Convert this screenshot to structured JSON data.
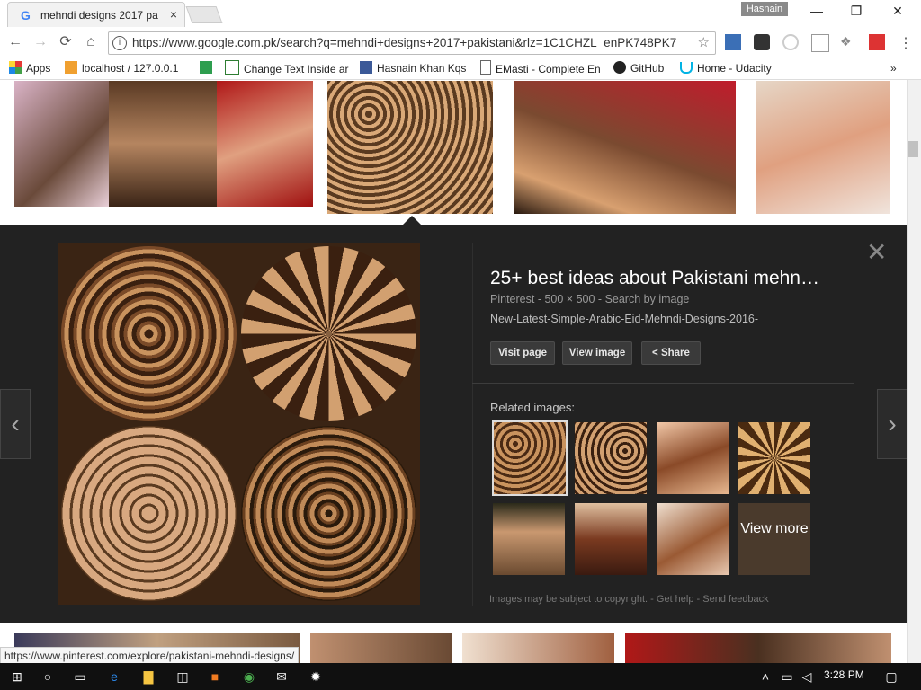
{
  "tab": {
    "title": "mehndi designs 2017 pa",
    "close": "×",
    "favicon": "G"
  },
  "window": {
    "user": "Hasnain",
    "minimize": "—",
    "maximize": "❐",
    "close": "✕"
  },
  "nav": {
    "back": "←",
    "forward": "→",
    "reload": "⟳",
    "home": "⌂"
  },
  "omnibox": {
    "url": "https://www.google.com.pk/search?q=mehndi+designs+2017+pakistani&rlz=1C1CHZL_enPK748PK7",
    "info": "i",
    "star": "☆"
  },
  "bookmarks": [
    {
      "label": "Apps",
      "icon": "apps-icon"
    },
    {
      "label": "localhost / 127.0.0.1",
      "icon": "pma-icon"
    },
    {
      "label": "",
      "icon": "w3-icon"
    },
    {
      "label": "Change Text Inside ar",
      "icon": "arrow-icon"
    },
    {
      "label": "Hasnain Khan Kqs",
      "icon": "facebook-icon"
    },
    {
      "label": "EMasti - Complete En",
      "icon": "page-icon"
    },
    {
      "label": "GitHub",
      "icon": "github-icon"
    },
    {
      "label": "Home - Udacity",
      "icon": "udacity-icon"
    }
  ],
  "bookmarks_more": "»",
  "detail": {
    "title": "25+ best ideas about Pakistani mehn…",
    "source": "Pinterest",
    "size": "500 × 500",
    "search_by_image": "Search by image",
    "filename": "New-Latest-Simple-Arabic-Eid-Mehndi-Designs-2016-",
    "visit_page": "Visit page",
    "view_image": "View image",
    "share": "Share",
    "related": "Related images:",
    "view_more": "View more",
    "copyright": "Images may be subject to copyright.",
    "get_help": "Get help",
    "send_feedback": "Send feedback",
    "close": "✕",
    "prev": "‹",
    "next": "›"
  },
  "status_url": "https://www.pinterest.com/explore/pakistani-mehndi-designs/",
  "taskbar": {
    "time": "3:28 PM"
  },
  "colors": {
    "panel": "#222222",
    "accent": "#4285f4"
  }
}
